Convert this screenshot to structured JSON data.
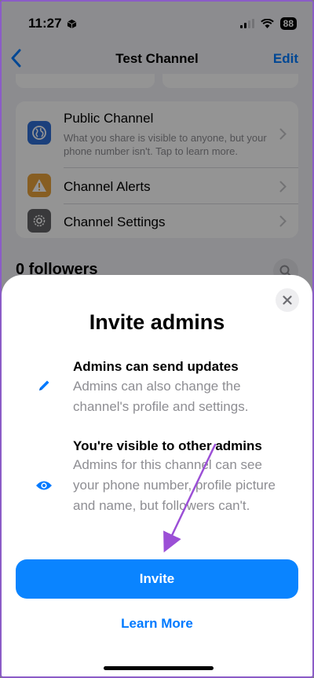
{
  "status_bar": {
    "time": "11:27",
    "battery": "88"
  },
  "nav": {
    "title": "Test Channel",
    "edit_label": "Edit"
  },
  "settings": [
    {
      "title": "Public Channel",
      "description": "What you share is visible to anyone, but your phone number isn't. Tap to learn more.",
      "icon": "globe-icon",
      "color": "#2f6fd6"
    },
    {
      "title": "Channel Alerts",
      "icon": "warning-icon",
      "color": "#e9a23b"
    },
    {
      "title": "Channel Settings",
      "icon": "gear-icon",
      "color": "#636366"
    }
  ],
  "followers_label": "0 followers",
  "sheet": {
    "title": "Invite admins",
    "features": [
      {
        "title": "Admins can send updates",
        "description": "Admins can also change the channel's profile and settings.",
        "icon": "pencil-icon"
      },
      {
        "title": "You're visible to other admins",
        "description": "Admins for this channel can see your phone number, profile picture and name, but followers can't.",
        "icon": "eye-icon"
      }
    ],
    "invite_label": "Invite",
    "learn_more_label": "Learn More"
  },
  "colors": {
    "accent": "#007aff",
    "button": "#0a84ff",
    "annotation": "#9b4fd6"
  }
}
